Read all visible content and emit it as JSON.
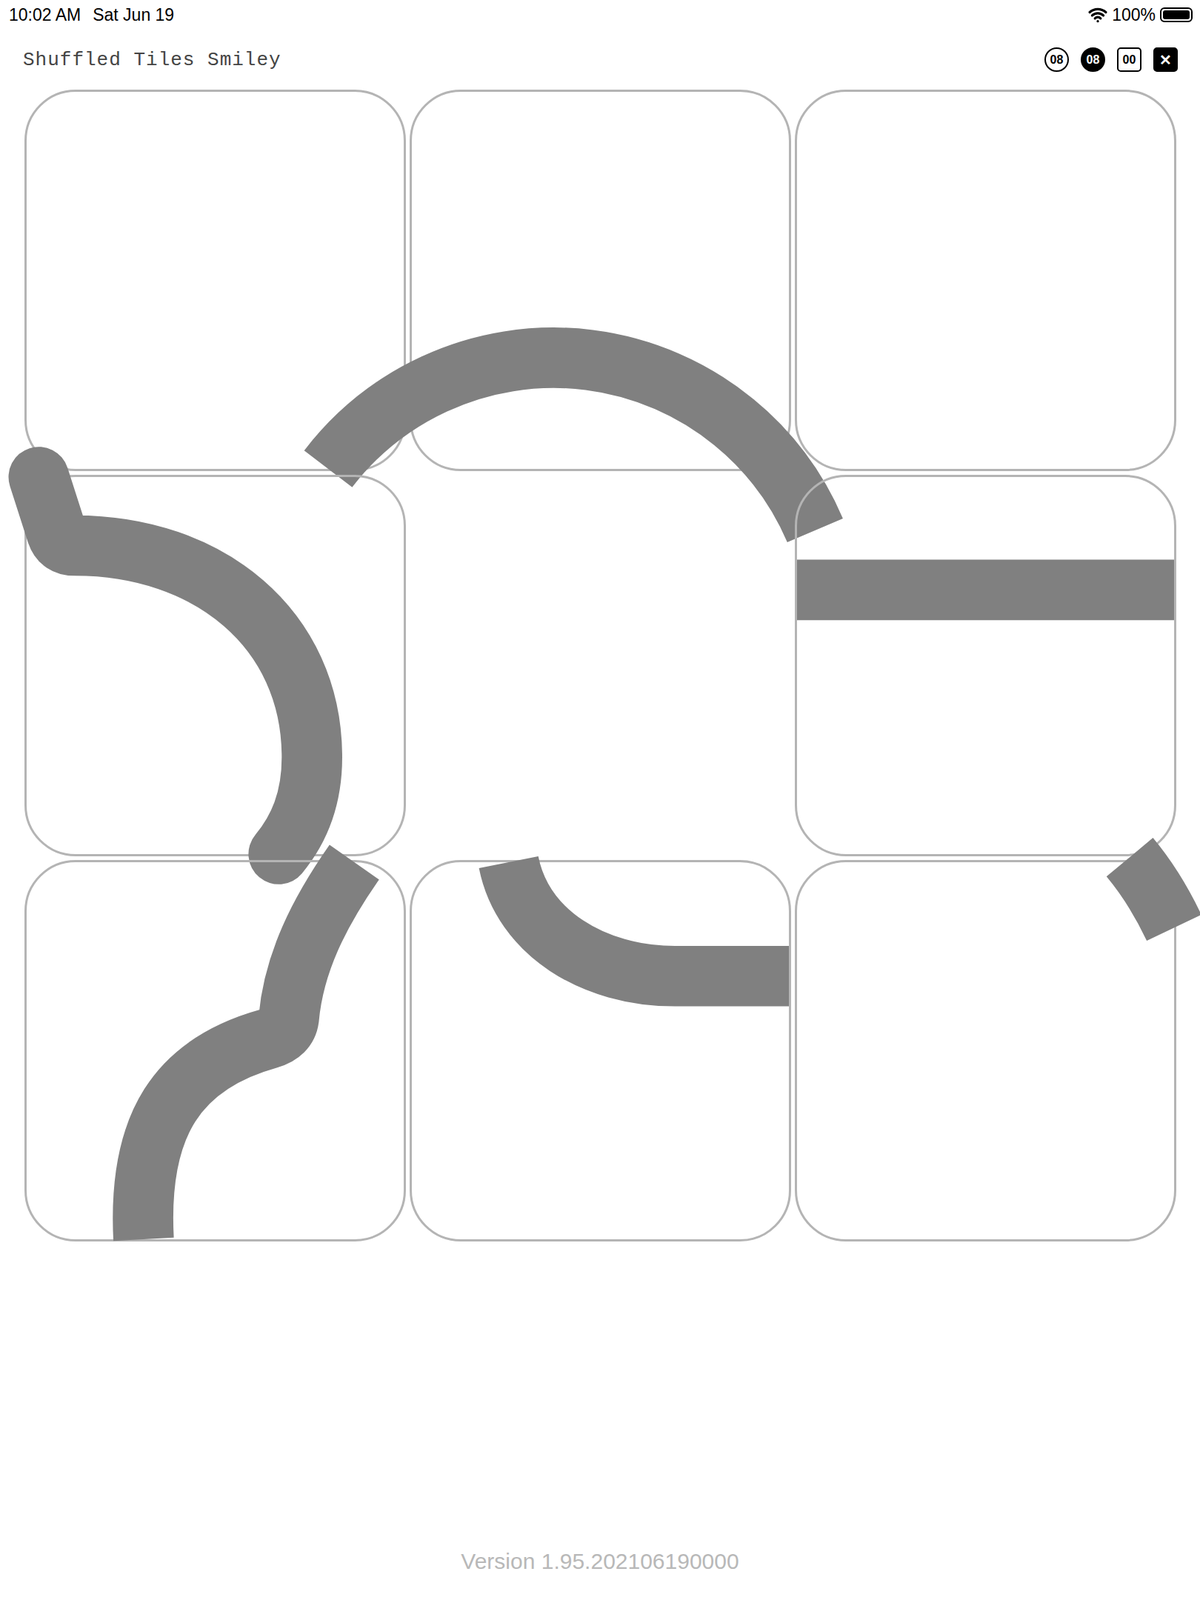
{
  "status_bar": {
    "time": "10:02 AM",
    "date": "Sat Jun 19",
    "battery": "100%",
    "battery_level": 1.0
  },
  "header": {
    "title": "Shuffled Tiles Smiley",
    "buttons": [
      {
        "label": "08",
        "kind": "outline"
      },
      {
        "label": "08",
        "kind": "filled"
      },
      {
        "label": "00",
        "kind": "square"
      },
      {
        "label": "✕",
        "kind": "close"
      }
    ]
  },
  "board": {
    "tiles": [
      {
        "empty": false
      },
      {
        "empty": false
      },
      {
        "empty": false
      },
      {
        "empty": false
      },
      {
        "empty": true
      },
      {
        "empty": false
      },
      {
        "empty": false
      },
      {
        "empty": false
      },
      {
        "empty": false
      }
    ]
  },
  "footer": {
    "version": "Version 1.95.202106190000"
  }
}
